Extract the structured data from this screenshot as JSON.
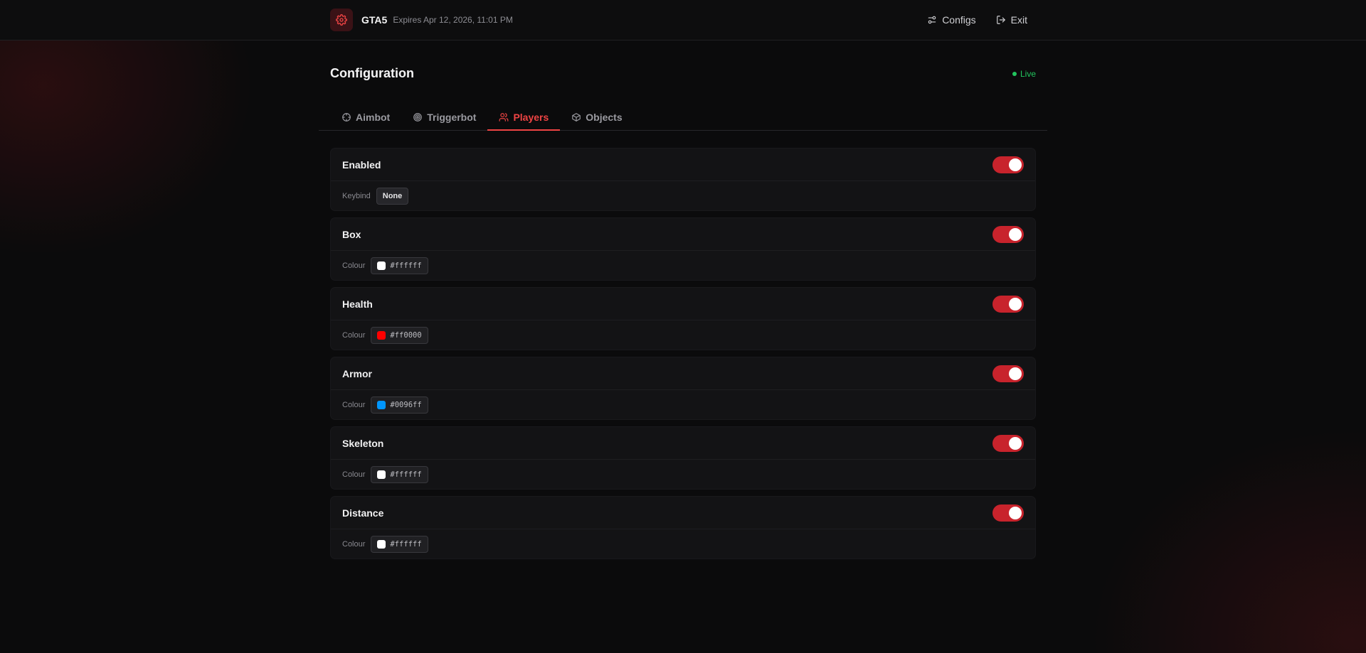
{
  "header": {
    "app_name": "GTA5",
    "expiry": "Expires Apr 12, 2026, 11:01 PM",
    "actions": {
      "configs": "Configs",
      "exit": "Exit"
    }
  },
  "page": {
    "title": "Configuration",
    "status": "Live"
  },
  "tabs": [
    {
      "label": "Aimbot",
      "icon": "crosshair-icon",
      "active": false
    },
    {
      "label": "Triggerbot",
      "icon": "target-icon",
      "active": false
    },
    {
      "label": "Players",
      "icon": "users-icon",
      "active": true
    },
    {
      "label": "Objects",
      "icon": "box-icon",
      "active": false
    }
  ],
  "cards": [
    {
      "title": "Enabled",
      "enabled": true,
      "field_label": "Keybind",
      "field_type": "keybind",
      "value": "None"
    },
    {
      "title": "Box",
      "enabled": true,
      "field_label": "Colour",
      "field_type": "color",
      "value": "#ffffff"
    },
    {
      "title": "Health",
      "enabled": true,
      "field_label": "Colour",
      "field_type": "color",
      "value": "#ff0000"
    },
    {
      "title": "Armor",
      "enabled": true,
      "field_label": "Colour",
      "field_type": "color",
      "value": "#0096ff"
    },
    {
      "title": "Skeleton",
      "enabled": true,
      "field_label": "Colour",
      "field_type": "color",
      "value": "#ffffff"
    },
    {
      "title": "Distance",
      "enabled": true,
      "field_label": "Colour",
      "field_type": "color",
      "value": "#ffffff"
    }
  ],
  "colors": {
    "accent": "#ef4444",
    "toggle_on": "#c8232c",
    "live": "#22c55e"
  }
}
